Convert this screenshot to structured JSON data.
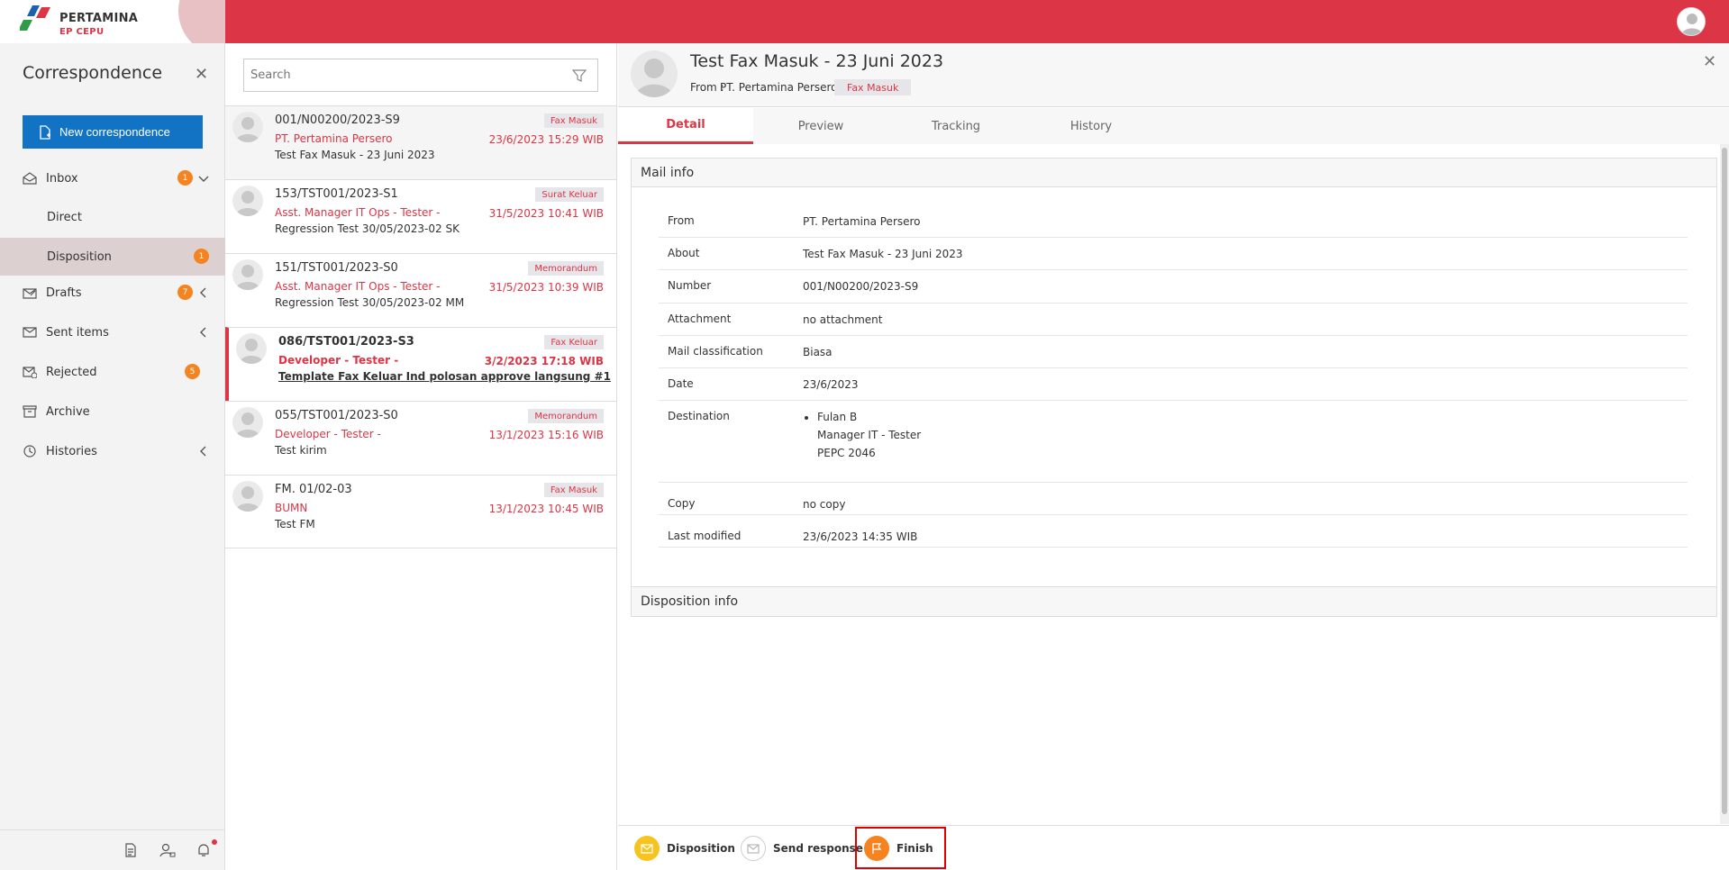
{
  "brand": {
    "name": "PERTAMINA",
    "sub": "EP CEPU"
  },
  "colors": {
    "accent": "#dc3545",
    "primary_button": "#1273c5",
    "badge": "#f5831f"
  },
  "sidebar": {
    "title": "Correspondence",
    "new_button": "New correspondence",
    "items": [
      {
        "label": "Inbox",
        "badge": "1",
        "icon": "inbox-icon"
      },
      {
        "label": "Direct"
      },
      {
        "label": "Disposition",
        "badge": "1"
      },
      {
        "label": "Drafts",
        "badge": "7",
        "icon": "drafts-icon"
      },
      {
        "label": "Sent items",
        "icon": "sent-icon"
      },
      {
        "label": "Rejected",
        "badge": "5",
        "icon": "rejected-icon"
      },
      {
        "label": "Archive",
        "icon": "archive-icon"
      },
      {
        "label": "Histories",
        "icon": "history-icon"
      }
    ]
  },
  "search": {
    "placeholder": "Search"
  },
  "mails": [
    {
      "number": "001/N00200/2023-S9",
      "sender": "PT. Pertamina Persero",
      "subject": "Test Fax Masuk - 23 Juni 2023",
      "tag": "Fax Masuk",
      "date": "23/6/2023 15:29 WIB"
    },
    {
      "number": "153/TST001/2023-S1",
      "sender": "Asst. Manager IT Ops - Tester -",
      "subject": "Regression Test 30/05/2023-02 SK",
      "tag": "Surat Keluar",
      "date": "31/5/2023 10:41 WIB"
    },
    {
      "number": "151/TST001/2023-S0",
      "sender": "Asst. Manager IT Ops - Tester -",
      "subject": "Regression Test 30/05/2023-02 MM",
      "tag": "Memorandum",
      "date": "31/5/2023 10:39 WIB"
    },
    {
      "number": "086/TST001/2023-S3",
      "sender": "Developer - Tester -",
      "subject": "Template Fax Keluar Ind polosan approve langsung #1",
      "tag": "Fax Keluar",
      "date": "3/2/2023 17:18 WIB"
    },
    {
      "number": "055/TST001/2023-S0",
      "sender": "Developer - Tester -",
      "subject": "Test kirim",
      "tag": "Memorandum",
      "date": "13/1/2023 15:16 WIB"
    },
    {
      "number": "FM. 01/02-03",
      "sender": "BUMN",
      "subject": "Test FM",
      "tag": "Fax Masuk",
      "date": "13/1/2023 10:45 WIB"
    }
  ],
  "detail": {
    "title": "Test Fax Masuk - 23 Juni 2023",
    "from_prefix": "From :",
    "from": "PT. Pertamina Persero",
    "tag": "Fax Masuk",
    "tabs": [
      "Detail",
      "Preview",
      "Tracking",
      "History"
    ],
    "mail_info_title": "Mail info",
    "fields": [
      {
        "key": "From",
        "value": "PT. Pertamina Persero"
      },
      {
        "key": "About",
        "value": "Test Fax Masuk - 23 Juni 2023"
      },
      {
        "key": "Number",
        "value": "001/N00200/2023-S9"
      },
      {
        "key": "Attachment",
        "value": "no attachment"
      },
      {
        "key": "Mail classification",
        "value": "Biasa"
      },
      {
        "key": "Date",
        "value": "23/6/2023"
      },
      {
        "key": "Destination",
        "name": "Fulan B",
        "position": "Manager IT - Tester",
        "code": "PEPC 2046"
      },
      {
        "key": "Copy",
        "value": "no copy"
      },
      {
        "key": "Last modified",
        "value": "23/6/2023 14:35 WIB"
      }
    ],
    "disposition_info_title": "Disposition info"
  },
  "actions": {
    "disposition": "Disposition",
    "send_response": "Send response",
    "finish": "Finish"
  }
}
